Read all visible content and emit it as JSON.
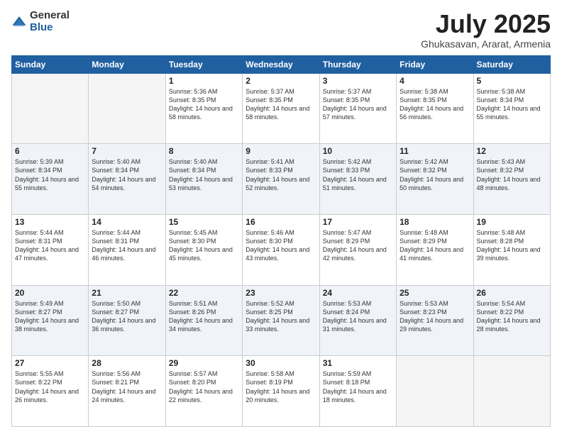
{
  "logo": {
    "general": "General",
    "blue": "Blue"
  },
  "header": {
    "month": "July 2025",
    "location": "Ghukasavan, Ararat, Armenia"
  },
  "weekdays": [
    "Sunday",
    "Monday",
    "Tuesday",
    "Wednesday",
    "Thursday",
    "Friday",
    "Saturday"
  ],
  "weeks": [
    [
      {
        "day": "",
        "empty": true
      },
      {
        "day": "",
        "empty": true
      },
      {
        "day": "1",
        "sunrise": "Sunrise: 5:36 AM",
        "sunset": "Sunset: 8:35 PM",
        "daylight": "Daylight: 14 hours and 58 minutes."
      },
      {
        "day": "2",
        "sunrise": "Sunrise: 5:37 AM",
        "sunset": "Sunset: 8:35 PM",
        "daylight": "Daylight: 14 hours and 58 minutes."
      },
      {
        "day": "3",
        "sunrise": "Sunrise: 5:37 AM",
        "sunset": "Sunset: 8:35 PM",
        "daylight": "Daylight: 14 hours and 57 minutes."
      },
      {
        "day": "4",
        "sunrise": "Sunrise: 5:38 AM",
        "sunset": "Sunset: 8:35 PM",
        "daylight": "Daylight: 14 hours and 56 minutes."
      },
      {
        "day": "5",
        "sunrise": "Sunrise: 5:38 AM",
        "sunset": "Sunset: 8:34 PM",
        "daylight": "Daylight: 14 hours and 55 minutes."
      }
    ],
    [
      {
        "day": "6",
        "sunrise": "Sunrise: 5:39 AM",
        "sunset": "Sunset: 8:34 PM",
        "daylight": "Daylight: 14 hours and 55 minutes."
      },
      {
        "day": "7",
        "sunrise": "Sunrise: 5:40 AM",
        "sunset": "Sunset: 8:34 PM",
        "daylight": "Daylight: 14 hours and 54 minutes."
      },
      {
        "day": "8",
        "sunrise": "Sunrise: 5:40 AM",
        "sunset": "Sunset: 8:34 PM",
        "daylight": "Daylight: 14 hours and 53 minutes."
      },
      {
        "day": "9",
        "sunrise": "Sunrise: 5:41 AM",
        "sunset": "Sunset: 8:33 PM",
        "daylight": "Daylight: 14 hours and 52 minutes."
      },
      {
        "day": "10",
        "sunrise": "Sunrise: 5:42 AM",
        "sunset": "Sunset: 8:33 PM",
        "daylight": "Daylight: 14 hours and 51 minutes."
      },
      {
        "day": "11",
        "sunrise": "Sunrise: 5:42 AM",
        "sunset": "Sunset: 8:32 PM",
        "daylight": "Daylight: 14 hours and 50 minutes."
      },
      {
        "day": "12",
        "sunrise": "Sunrise: 5:43 AM",
        "sunset": "Sunset: 8:32 PM",
        "daylight": "Daylight: 14 hours and 48 minutes."
      }
    ],
    [
      {
        "day": "13",
        "sunrise": "Sunrise: 5:44 AM",
        "sunset": "Sunset: 8:31 PM",
        "daylight": "Daylight: 14 hours and 47 minutes."
      },
      {
        "day": "14",
        "sunrise": "Sunrise: 5:44 AM",
        "sunset": "Sunset: 8:31 PM",
        "daylight": "Daylight: 14 hours and 46 minutes."
      },
      {
        "day": "15",
        "sunrise": "Sunrise: 5:45 AM",
        "sunset": "Sunset: 8:30 PM",
        "daylight": "Daylight: 14 hours and 45 minutes."
      },
      {
        "day": "16",
        "sunrise": "Sunrise: 5:46 AM",
        "sunset": "Sunset: 8:30 PM",
        "daylight": "Daylight: 14 hours and 43 minutes."
      },
      {
        "day": "17",
        "sunrise": "Sunrise: 5:47 AM",
        "sunset": "Sunset: 8:29 PM",
        "daylight": "Daylight: 14 hours and 42 minutes."
      },
      {
        "day": "18",
        "sunrise": "Sunrise: 5:48 AM",
        "sunset": "Sunset: 8:29 PM",
        "daylight": "Daylight: 14 hours and 41 minutes."
      },
      {
        "day": "19",
        "sunrise": "Sunrise: 5:48 AM",
        "sunset": "Sunset: 8:28 PM",
        "daylight": "Daylight: 14 hours and 39 minutes."
      }
    ],
    [
      {
        "day": "20",
        "sunrise": "Sunrise: 5:49 AM",
        "sunset": "Sunset: 8:27 PM",
        "daylight": "Daylight: 14 hours and 38 minutes."
      },
      {
        "day": "21",
        "sunrise": "Sunrise: 5:50 AM",
        "sunset": "Sunset: 8:27 PM",
        "daylight": "Daylight: 14 hours and 36 minutes."
      },
      {
        "day": "22",
        "sunrise": "Sunrise: 5:51 AM",
        "sunset": "Sunset: 8:26 PM",
        "daylight": "Daylight: 14 hours and 34 minutes."
      },
      {
        "day": "23",
        "sunrise": "Sunrise: 5:52 AM",
        "sunset": "Sunset: 8:25 PM",
        "daylight": "Daylight: 14 hours and 33 minutes."
      },
      {
        "day": "24",
        "sunrise": "Sunrise: 5:53 AM",
        "sunset": "Sunset: 8:24 PM",
        "daylight": "Daylight: 14 hours and 31 minutes."
      },
      {
        "day": "25",
        "sunrise": "Sunrise: 5:53 AM",
        "sunset": "Sunset: 8:23 PM",
        "daylight": "Daylight: 14 hours and 29 minutes."
      },
      {
        "day": "26",
        "sunrise": "Sunrise: 5:54 AM",
        "sunset": "Sunset: 8:22 PM",
        "daylight": "Daylight: 14 hours and 28 minutes."
      }
    ],
    [
      {
        "day": "27",
        "sunrise": "Sunrise: 5:55 AM",
        "sunset": "Sunset: 8:22 PM",
        "daylight": "Daylight: 14 hours and 26 minutes."
      },
      {
        "day": "28",
        "sunrise": "Sunrise: 5:56 AM",
        "sunset": "Sunset: 8:21 PM",
        "daylight": "Daylight: 14 hours and 24 minutes."
      },
      {
        "day": "29",
        "sunrise": "Sunrise: 5:57 AM",
        "sunset": "Sunset: 8:20 PM",
        "daylight": "Daylight: 14 hours and 22 minutes."
      },
      {
        "day": "30",
        "sunrise": "Sunrise: 5:58 AM",
        "sunset": "Sunset: 8:19 PM",
        "daylight": "Daylight: 14 hours and 20 minutes."
      },
      {
        "day": "31",
        "sunrise": "Sunrise: 5:59 AM",
        "sunset": "Sunset: 8:18 PM",
        "daylight": "Daylight: 14 hours and 18 minutes."
      },
      {
        "day": "",
        "empty": true
      },
      {
        "day": "",
        "empty": true
      }
    ]
  ]
}
